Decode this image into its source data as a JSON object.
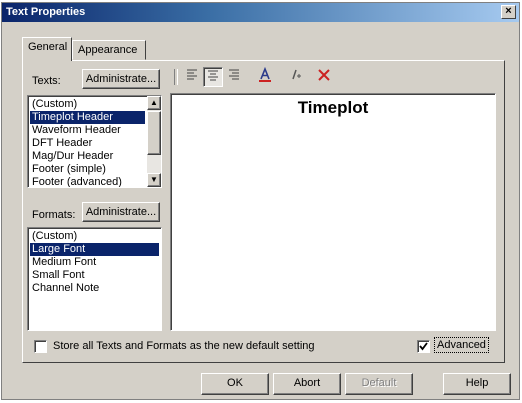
{
  "window": {
    "title": "Text Properties",
    "close_glyph": "×"
  },
  "tabs": [
    {
      "label": "General",
      "active": true
    },
    {
      "label": "Appearance",
      "active": false
    }
  ],
  "texts": {
    "label": "Texts:",
    "administrate_label": "Administrate...",
    "items": [
      "(Custom)",
      "Timeplot Header",
      "Waveform Header",
      "DFT Header",
      "Mag/Dur Header",
      "Footer (simple)",
      "Footer (advanced)"
    ],
    "selected_index": 1
  },
  "formats": {
    "label": "Formats:",
    "administrate_label": "Administrate...",
    "items": [
      "(Custom)",
      "Large Font",
      "Medium Font",
      "Small Font",
      "Channel Note"
    ],
    "selected_index": 1
  },
  "toolbar": {
    "icons": [
      "align-left-icon",
      "align-center-icon",
      "align-right-icon",
      "text-color-icon",
      "italic-icon",
      "delete-icon"
    ],
    "align_center_pressed": true,
    "accent_red": "#cc2222"
  },
  "preview": {
    "text": "Timeplot"
  },
  "options": {
    "store_default_label": "Store all Texts and Formats as the new default setting",
    "store_default_checked": false,
    "advanced_label": "Advanced",
    "advanced_checked": true
  },
  "buttons": {
    "ok": "OK",
    "abort": "Abort",
    "default": "Default",
    "help": "Help"
  }
}
